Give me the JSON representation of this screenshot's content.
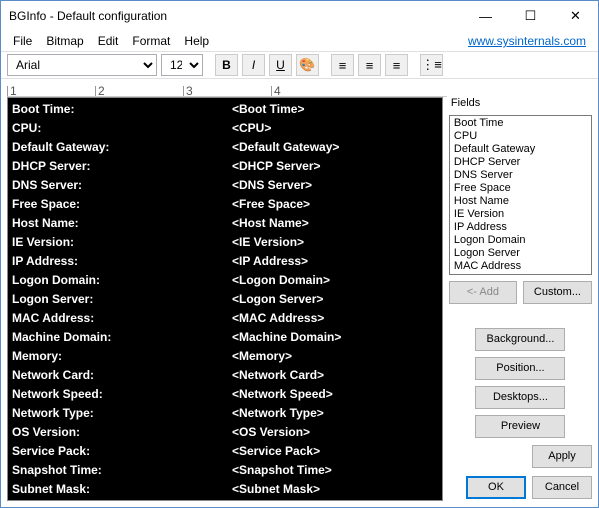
{
  "window": {
    "title": "BGInfo - Default configuration"
  },
  "menu": {
    "file": "File",
    "bitmap": "Bitmap",
    "edit": "Edit",
    "format": "Format",
    "help": "Help",
    "link": "www.sysinternals.com"
  },
  "toolbar": {
    "font": "Arial",
    "size": "12"
  },
  "ruler": [
    "1",
    "2",
    "3",
    "4"
  ],
  "editor": [
    {
      "label": "Boot Time:",
      "value": "<Boot Time>"
    },
    {
      "label": "CPU:",
      "value": "<CPU>"
    },
    {
      "label": "Default Gateway:",
      "value": "<Default Gateway>"
    },
    {
      "label": "DHCP Server:",
      "value": "<DHCP Server>"
    },
    {
      "label": "DNS Server:",
      "value": "<DNS Server>"
    },
    {
      "label": "Free Space:",
      "value": "<Free Space>"
    },
    {
      "label": "Host Name:",
      "value": "<Host Name>"
    },
    {
      "label": "IE Version:",
      "value": "<IE Version>"
    },
    {
      "label": "IP Address:",
      "value": "<IP Address>"
    },
    {
      "label": "Logon Domain:",
      "value": "<Logon Domain>"
    },
    {
      "label": "Logon Server:",
      "value": "<Logon Server>"
    },
    {
      "label": "MAC Address:",
      "value": "<MAC Address>"
    },
    {
      "label": "Machine Domain:",
      "value": "<Machine Domain>"
    },
    {
      "label": "Memory:",
      "value": "<Memory>"
    },
    {
      "label": "Network Card:",
      "value": "<Network Card>"
    },
    {
      "label": "Network Speed:",
      "value": "<Network Speed>"
    },
    {
      "label": "Network Type:",
      "value": "<Network Type>"
    },
    {
      "label": "OS Version:",
      "value": "<OS Version>"
    },
    {
      "label": "Service Pack:",
      "value": "<Service Pack>"
    },
    {
      "label": "Snapshot Time:",
      "value": "<Snapshot Time>"
    },
    {
      "label": "Subnet Mask:",
      "value": "<Subnet Mask>"
    }
  ],
  "fields": {
    "label": "Fields",
    "items": [
      "Boot Time",
      "CPU",
      "Default Gateway",
      "DHCP Server",
      "DNS Server",
      "Free Space",
      "Host Name",
      "IE Version",
      "IP Address",
      "Logon Domain",
      "Logon Server",
      "MAC Address"
    ]
  },
  "buttons": {
    "add": "<- Add",
    "custom": "Custom...",
    "background": "Background...",
    "position": "Position...",
    "desktops": "Desktops...",
    "preview": "Preview",
    "apply": "Apply",
    "ok": "OK",
    "cancel": "Cancel"
  }
}
